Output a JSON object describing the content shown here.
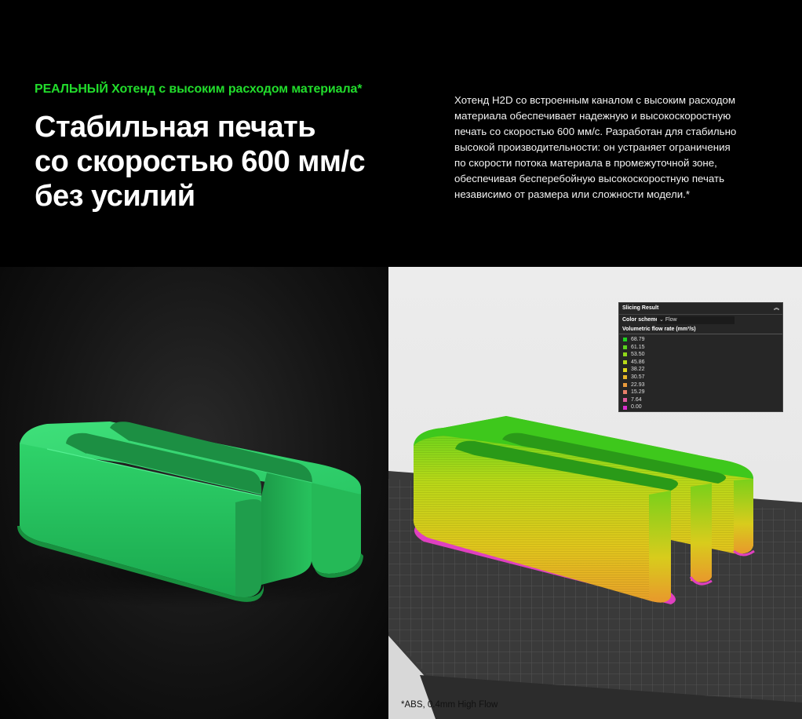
{
  "hero": {
    "eyebrow": "РЕАЛЬНЫЙ Хотенд с высоким расходом материала*",
    "headline": [
      "Стабильная печать",
      "со скоростью 600 мм/с",
      "без усилий"
    ],
    "description": [
      "Хотенд H2D со встроенным каналом с высоким расходом",
      "материала обеспечивает надежную и высокоскоростную",
      "печать со скоростью 600 мм/с. Разработан для стабильно",
      "высокой производительности: он устраняет ограничения",
      "по скорости потока материала в промежуточной зоне,",
      "обеспечивая бесперебойную высокоскоростную печать",
      "независимо от размера или сложности модели.*"
    ],
    "accent_color": "#22dd2c"
  },
  "slicing_result": {
    "title": "Slicing Result",
    "color_scheme_label": "Color scheme",
    "color_scheme_value": "Flow",
    "legend_title": "Volumetric flow rate (mm³/s)",
    "legend": [
      {
        "value": "68.79",
        "color": "#1fd11f"
      },
      {
        "value": "61.15",
        "color": "#5ad41c"
      },
      {
        "value": "53.50",
        "color": "#8fd61a"
      },
      {
        "value": "45.86",
        "color": "#b8d818"
      },
      {
        "value": "38.22",
        "color": "#e0d61c"
      },
      {
        "value": "30.57",
        "color": "#e8b428"
      },
      {
        "value": "22.93",
        "color": "#e89a3c"
      },
      {
        "value": "15.29",
        "color": "#e8806a"
      },
      {
        "value": "7.64",
        "color": "#e05aa0"
      },
      {
        "value": "0.00",
        "color": "#d92ccf"
      }
    ]
  },
  "footnote": "*ABS, 0.4mm High Flow"
}
